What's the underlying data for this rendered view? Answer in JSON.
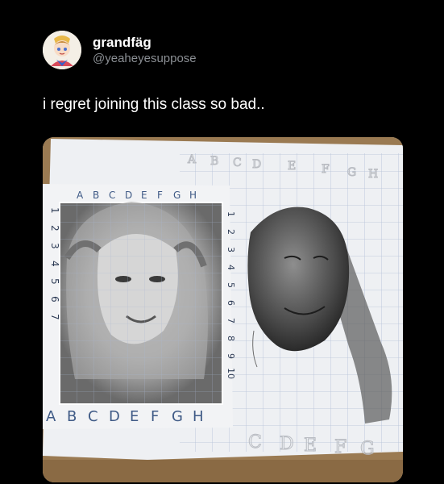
{
  "tweet": {
    "display_name": "grandfäg",
    "handle": "@yeaheyesuppose",
    "text": "i regret joining this class so bad..",
    "avatar_icon": "anime-avatar-icon"
  },
  "photo": {
    "grid_letters": [
      "A",
      "B",
      "C",
      "D",
      "E",
      "F",
      "G",
      "H"
    ],
    "grid_numbers": [
      "1",
      "2",
      "3",
      "4",
      "5",
      "6",
      "7"
    ],
    "right_numbers": [
      "1",
      "2",
      "3",
      "4",
      "5",
      "6",
      "7",
      "8",
      "9",
      "10"
    ],
    "drawing_letters": [
      "A",
      "B",
      "C",
      "D",
      "E",
      "F",
      "G",
      "H"
    ],
    "bottom_drawing_letters": [
      "C",
      "D",
      "E",
      "F",
      "G"
    ]
  }
}
